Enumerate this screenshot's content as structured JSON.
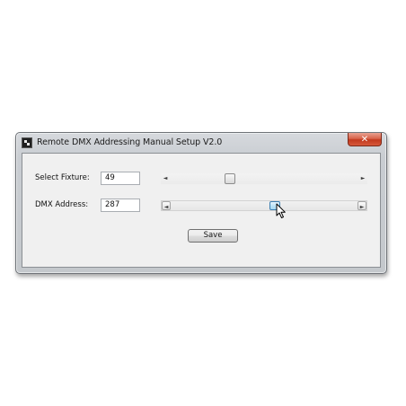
{
  "window": {
    "title": "Remote DMX Addressing Manual Setup V2.0",
    "close_label": "✕",
    "app_icon": "dmx-app-icon"
  },
  "fixture": {
    "label": "Select Fixture:",
    "value": "49",
    "slider_position_fraction": 0.31
  },
  "address": {
    "label": "DMX Address:",
    "value": "287",
    "slider_position_fraction": 0.56
  },
  "actions": {
    "save_label": "Save"
  },
  "icons": {
    "scroll_left": "◄",
    "scroll_right": "►"
  },
  "colors": {
    "close_button": "#c2391e",
    "thumb_hover": "#bde4f8"
  }
}
